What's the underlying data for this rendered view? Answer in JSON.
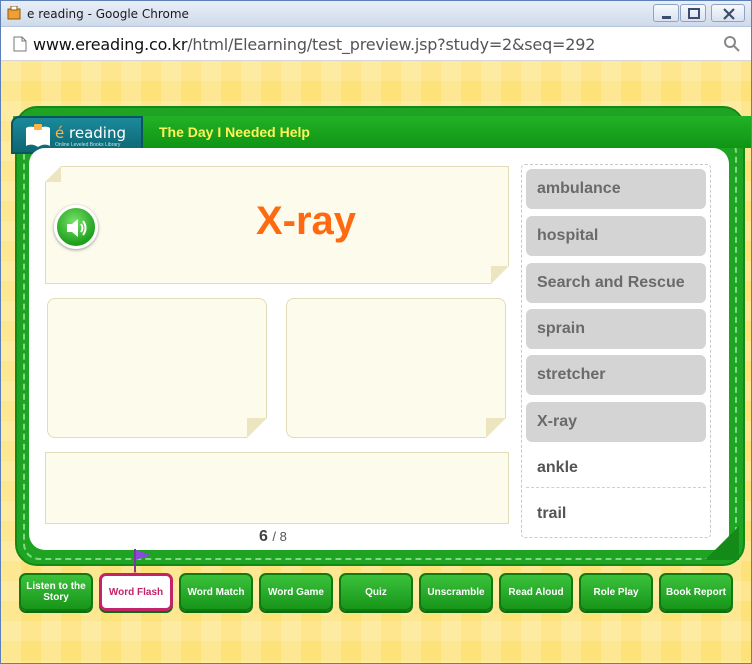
{
  "window": {
    "title": "e reading - Google Chrome",
    "url_host": "www.ereading.co.kr",
    "url_path": "/html/Elearning/test_preview.jsp?study=2&seq=292"
  },
  "header": {
    "logo_e": "é",
    "logo_text": "reading",
    "logo_sub": "Online Leveled Books Library",
    "story_title": "The Day I Needed Help"
  },
  "flash": {
    "current_word": "X-ray",
    "page_current": "6",
    "page_total": "/ 8"
  },
  "word_list": [
    {
      "label": "ambulance",
      "state": "filled"
    },
    {
      "label": "hospital",
      "state": "filled"
    },
    {
      "label": "Search and Rescue",
      "state": "filled"
    },
    {
      "label": "sprain",
      "state": "filled"
    },
    {
      "label": "stretcher",
      "state": "filled"
    },
    {
      "label": "X-ray",
      "state": "filled"
    },
    {
      "label": "ankle",
      "state": "plain"
    },
    {
      "label": "trail",
      "state": "plain"
    }
  ],
  "nav": [
    {
      "label": "Listen to the Story",
      "active": false
    },
    {
      "label": "Word Flash",
      "active": true
    },
    {
      "label": "Word Match",
      "active": false
    },
    {
      "label": "Word Game",
      "active": false
    },
    {
      "label": "Quiz",
      "active": false
    },
    {
      "label": "Unscramble",
      "active": false
    },
    {
      "label": "Read Aloud",
      "active": false
    },
    {
      "label": "Role Play",
      "active": false
    },
    {
      "label": "Book Report",
      "active": false
    }
  ],
  "colors": {
    "frame_green": "#1ea323",
    "word_orange": "#ff6a10",
    "title_yellow": "#fff35a",
    "active_pink": "#c4236a"
  }
}
